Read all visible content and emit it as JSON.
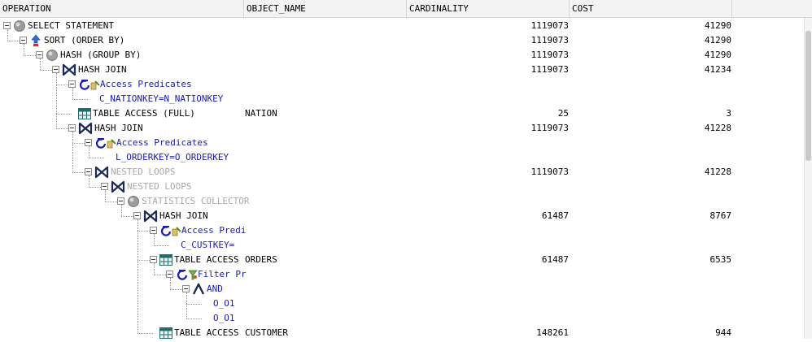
{
  "columns": [
    "OPERATION",
    "OBJECT_NAME",
    "CARDINALITY",
    "COST"
  ],
  "colors": {
    "predicate_blue": "#1a1ab8",
    "inactive_grey": "#a8a8a8",
    "table_icon": "#1f6d6d"
  },
  "rows": [
    {
      "label": "SELECT STATEMENT",
      "object": "",
      "cardinality": "1119073",
      "cost": "41290",
      "icon": "statement-icon",
      "style": "normal"
    },
    {
      "label": "SORT (ORDER BY)",
      "object": "",
      "cardinality": "1119073",
      "cost": "41290",
      "icon": "sort-icon",
      "style": "normal"
    },
    {
      "label": "HASH (GROUP BY)",
      "object": "",
      "cardinality": "1119073",
      "cost": "41290",
      "icon": "hash-group-icon",
      "style": "normal"
    },
    {
      "label": "HASH JOIN",
      "object": "",
      "cardinality": "1119073",
      "cost": "41234",
      "icon": "join-icon",
      "style": "normal"
    },
    {
      "label": "Access Predicates",
      "object": "",
      "cardinality": "",
      "cost": "",
      "icon": "predicate-icon",
      "style": "blue"
    },
    {
      "label": "C_NATIONKEY=N_NATIONKEY",
      "object": "",
      "cardinality": "",
      "cost": "",
      "icon": "",
      "style": "blue"
    },
    {
      "label": "TABLE ACCESS (FULL)",
      "object": "NATION",
      "cardinality": "25",
      "cost": "3",
      "icon": "table-icon",
      "style": "normal"
    },
    {
      "label": "HASH JOIN",
      "object": "",
      "cardinality": "1119073",
      "cost": "41228",
      "icon": "join-icon",
      "style": "normal"
    },
    {
      "label": "Access Predicates",
      "object": "",
      "cardinality": "",
      "cost": "",
      "icon": "predicate-icon",
      "style": "blue"
    },
    {
      "label": "L_ORDERKEY=O_ORDERKEY",
      "object": "",
      "cardinality": "",
      "cost": "",
      "icon": "",
      "style": "blue"
    },
    {
      "label": "NESTED LOOPS",
      "object": "",
      "cardinality": "1119073",
      "cost": "41228",
      "icon": "join-icon",
      "style": "grey"
    },
    {
      "label": "NESTED LOOPS",
      "object": "",
      "cardinality": "",
      "cost": "",
      "icon": "join-icon",
      "style": "grey"
    },
    {
      "label": "STATISTICS COLLECTOR",
      "object": "",
      "cardinality": "",
      "cost": "",
      "icon": "statement-icon",
      "style": "grey"
    },
    {
      "label": "HASH JOIN",
      "object": "",
      "cardinality": "61487",
      "cost": "8767",
      "icon": "join-icon",
      "style": "normal"
    },
    {
      "label": "Access Predi",
      "object": "",
      "cardinality": "",
      "cost": "",
      "icon": "predicate-icon",
      "style": "blue"
    },
    {
      "label": "C_CUSTKEY=",
      "object": "",
      "cardinality": "",
      "cost": "",
      "icon": "",
      "style": "blue"
    },
    {
      "label": "TABLE ACCESS",
      "object": "ORDERS",
      "cardinality": "61487",
      "cost": "6535",
      "icon": "table-icon",
      "style": "normal"
    },
    {
      "label": "Filter Pr",
      "object": "",
      "cardinality": "",
      "cost": "",
      "icon": "filter-icon",
      "style": "blue"
    },
    {
      "label": "AND",
      "object": "",
      "cardinality": "",
      "cost": "",
      "icon": "and-icon",
      "style": "blue"
    },
    {
      "label": "O_O1",
      "object": "",
      "cardinality": "",
      "cost": "",
      "icon": "",
      "style": "blue"
    },
    {
      "label": "O_O1",
      "object": "",
      "cardinality": "",
      "cost": "",
      "icon": "",
      "style": "blue"
    },
    {
      "label": "TABLE ACCESS",
      "object": "CUSTOMER",
      "cardinality": "148261",
      "cost": "944",
      "icon": "table-icon",
      "style": "normal"
    }
  ]
}
